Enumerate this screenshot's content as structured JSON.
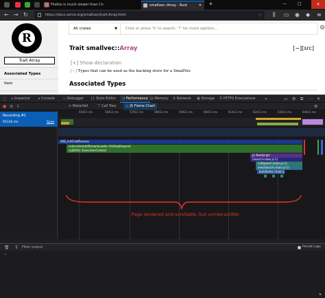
{
  "browser": {
    "tabs": [
      {
        "label": "Firefox is much slower than Ch",
        "active": false
      },
      {
        "label": "smallvec::Array - Rust",
        "active": true
      }
    ],
    "url": "https://docs.servo.org/smallvec/trait.Array.html",
    "window_controls": [
      "—",
      "□",
      "✕"
    ]
  },
  "page": {
    "sidebar": {
      "logo_letter": "R",
      "title": "Trait Array",
      "items": [
        "Associated Types",
        "Item"
      ]
    },
    "search": {
      "crate_select": "All crates",
      "placeholder": "Click or press 'S' to search, '?' for more options..."
    },
    "heading": {
      "prefix": "Trait smallvec::",
      "name": "Array"
    },
    "src_link": "[−][src]",
    "show_declaration": "[+]  Show declaration",
    "doc_toggle": "[−]",
    "doc_text": "Types that can be used as the backing store for a SmallVec",
    "associated_types_heading": "Associated Types"
  },
  "devtools": {
    "tabs": [
      "Inspector",
      "Console",
      "Debugger",
      "Style Editor",
      "Performance",
      "Memory",
      "Network",
      "Storage",
      "HTTPS Everywhere"
    ],
    "active_tab": "Performance",
    "perf_tabs": [
      "Waterfall",
      "Call Tree",
      "JS Flame Chart"
    ],
    "active_perf_tab": "JS Flame Chart",
    "recording": {
      "name": "Recording #1",
      "duration": "65126 ms",
      "save_label": "Save"
    },
    "ruler_ticks": [
      "55411 ms",
      "56411 ms",
      "57411 ms",
      "58411 ms",
      "59411 ms",
      "60411 ms",
      "61411 ms",
      "62411 ms",
      "63411 ms",
      "64411 ms"
    ],
    "flame_rows": [
      {
        "label": "XRE_InitChildProcess"
      },
      {
        "label": "nsIncrementalStreamLoader::OnStopRequest"
      },
      {
        "label": "nsJSUtils::ExecutionContext"
      },
      {
        "label": "js::RunScript"
      },
      {
        "label": "(search-index.js:1)"
      },
      {
        "label": "initSearch (main.js:1)"
      },
      {
        "label": "execSearch (main.js:1)"
      },
      {
        "label": "buildIndex (main.js:1)"
      }
    ],
    "annotation": "Page rendered and scrollable, but uninteractible",
    "console": {
      "filter_placeholder": "Filter output",
      "persist_logs": "Persist Logs"
    }
  }
}
